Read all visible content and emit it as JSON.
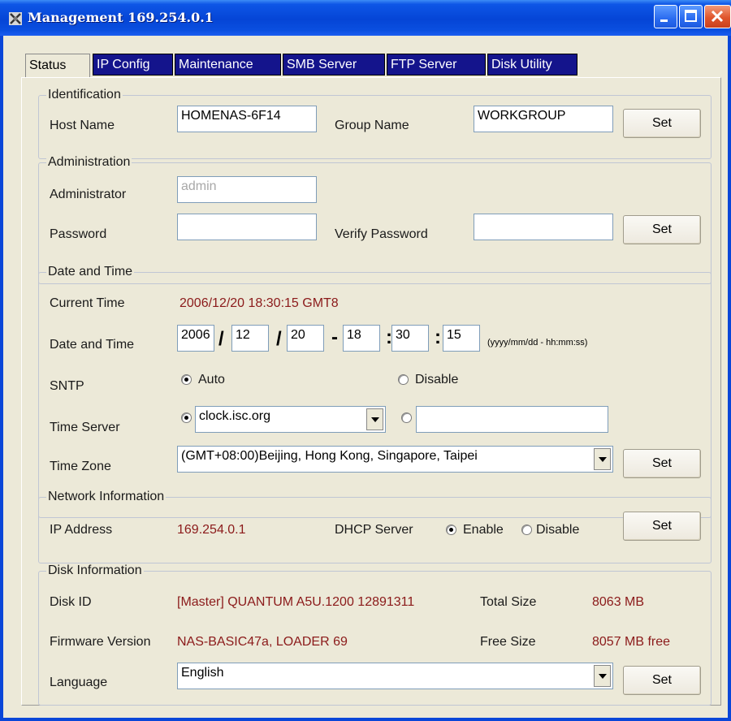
{
  "window": {
    "title": "Management 169.254.0.1"
  },
  "tabs": [
    "Status",
    "IP Config",
    "Maintenance",
    "SMB Server",
    "FTP Server",
    "Disk Utility"
  ],
  "identification": {
    "legend": "Identification",
    "host_name_label": "Host Name",
    "host_name_value": "HOMENAS-6F14",
    "group_name_label": "Group Name",
    "group_name_value": "WORKGROUP",
    "set_label": "Set"
  },
  "administration": {
    "legend": "Administration",
    "administrator_label": "Administrator",
    "administrator_value": "admin",
    "password_label": "Password",
    "verify_password_label": "Verify Password",
    "set_label": "Set"
  },
  "datetime": {
    "legend": "Date and Time",
    "current_time_label": "Current Time",
    "current_time_value": "2006/12/20 18:30:15 GMT8",
    "date_time_label": "Date and Time",
    "year": "2006",
    "month": "12",
    "day": "20",
    "hour": "18",
    "minute": "30",
    "second": "15",
    "sep_slash": "/",
    "sep_dash": "-",
    "sep_colon": ":",
    "format_hint": "(yyyy/mm/dd - hh:mm:ss)",
    "sntp_label": "SNTP",
    "sntp_auto": "Auto",
    "sntp_disable": "Disable",
    "time_server_label": "Time Server",
    "time_server_value": "clock.isc.org",
    "time_server_custom": "",
    "time_zone_label": "Time Zone",
    "time_zone_value": "(GMT+08:00)Beijing, Hong Kong, Singapore, Taipei",
    "set_label": "Set"
  },
  "network": {
    "legend": "Network Information",
    "ip_label": "IP Address",
    "ip_value": "169.254.0.1",
    "dhcp_label": "DHCP Server",
    "dhcp_enable": "Enable",
    "dhcp_disable": "Disable",
    "set_label": "Set"
  },
  "disk": {
    "legend": "Disk Information",
    "disk_id_label": "Disk ID",
    "disk_id_value": "[Master] QUANTUM A5U.1200 12891311",
    "total_size_label": "Total Size",
    "total_size_value": "8063 MB",
    "firmware_label": "Firmware Version",
    "firmware_value": "NAS-BASIC47a, LOADER  69",
    "free_size_label": "Free Size",
    "free_size_value": "8057 MB free",
    "language_label": "Language",
    "language_value": "English",
    "set_label": "Set"
  }
}
